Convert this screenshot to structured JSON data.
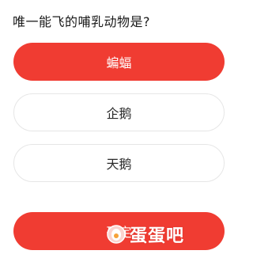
{
  "question": {
    "text": "唯一能飞的哺乳动物是?"
  },
  "options": [
    {
      "label": "蝙蝠",
      "selected": true
    },
    {
      "label": "企鹅",
      "selected": false
    },
    {
      "label": "天鹅",
      "selected": false
    }
  ],
  "confirm": {
    "label": "确定"
  },
  "watermark": {
    "text": "蛋蛋吧",
    "icon": "egg-logo-icon"
  },
  "colors": {
    "accent": "#f03c32",
    "option_border": "#e6e6e6",
    "text": "#1a1a1a"
  }
}
